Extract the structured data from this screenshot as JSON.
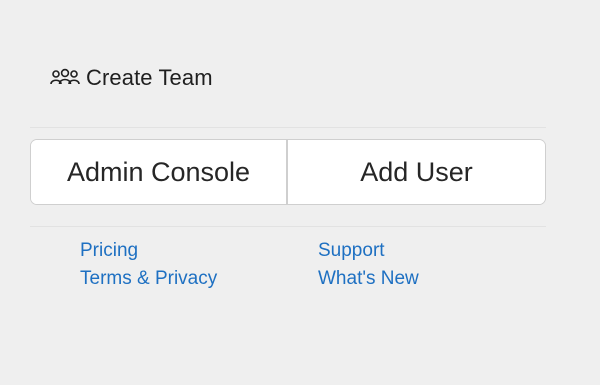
{
  "create_team": {
    "icon": "team-icon",
    "label": "Create Team"
  },
  "buttons": {
    "admin_console": "Admin Console",
    "add_user": "Add User"
  },
  "links": {
    "pricing": "Pricing",
    "terms_privacy": "Terms & Privacy",
    "support": "Support",
    "whats_new": "What's New"
  },
  "colors": {
    "background": "#efefef",
    "link": "#1e70c2",
    "button_border": "#cfcfcf"
  }
}
